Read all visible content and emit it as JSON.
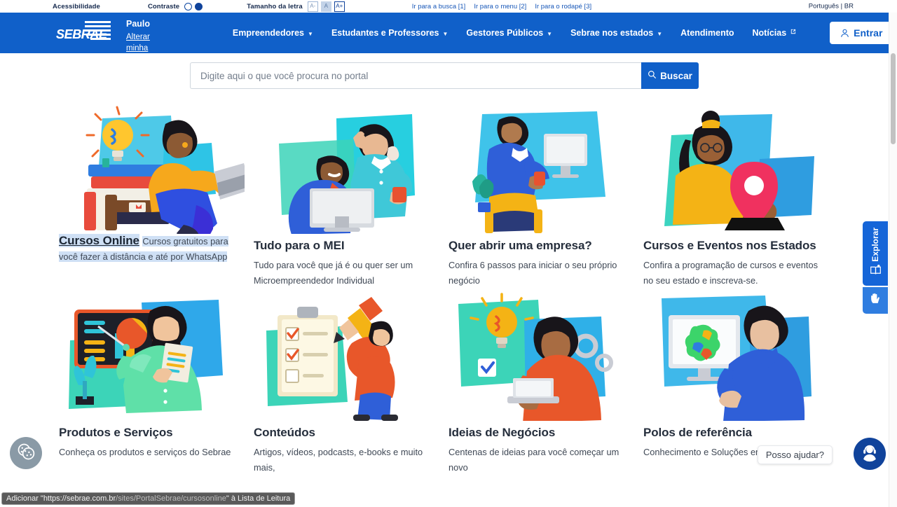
{
  "accessibility_bar": {
    "accessibility_label": "Acessibilidade",
    "contrast_label": "Contraste",
    "font_size_label": "Tamanho da letra",
    "font_small": "A-",
    "font_normal": "A",
    "font_large": "A+",
    "skip_links": [
      "Ir para a busca [1]",
      "Ir para o menu [2]",
      "Ir para o rodapé [3]"
    ],
    "language": "Português | BR"
  },
  "navbar": {
    "logo_text": "SEBRAE",
    "location_city": "São Paulo",
    "location_change": "Alterar minha localização",
    "menu": [
      {
        "label": "Empreendedores",
        "has_chevron": true,
        "external": false
      },
      {
        "label": "Estudantes e Professores",
        "has_chevron": true,
        "external": false
      },
      {
        "label": "Gestores Públicos",
        "has_chevron": true,
        "external": false
      },
      {
        "label": "Sebrae nos estados",
        "has_chevron": true,
        "external": false
      },
      {
        "label": "Atendimento",
        "has_chevron": false,
        "external": false
      },
      {
        "label": "Notícias",
        "has_chevron": false,
        "external": true
      }
    ],
    "login_label": "Entrar",
    "login_icon": "person-icon",
    "brand_color": "#1060c9"
  },
  "search": {
    "placeholder": "Digite aqui o que você procura no portal",
    "value": "",
    "button_label": "Buscar",
    "button_icon": "search-icon"
  },
  "cards": [
    {
      "title": "Cursos Online",
      "description": "Cursos gratuitos para você fazer à distância e até por WhatsApp",
      "selected": true,
      "art": "person-on-books-with-laptop"
    },
    {
      "title": "Tudo para o MEI",
      "description": "Tudo para você que já é ou quer ser um Microempreendedor Individual",
      "selected": false,
      "art": "two-people-at-monitor"
    },
    {
      "title": "Quer abrir uma empresa?",
      "description": "Confira 6 passos para iniciar o seu próprio negócio",
      "selected": false,
      "art": "person-at-desk-computer"
    },
    {
      "title": "Cursos e Eventos nos Estados",
      "description": "Confira a programação de cursos e eventos no seu estado e inscreva-se.",
      "selected": false,
      "art": "woman-with-map-pin"
    },
    {
      "title": "Produtos e Serviços",
      "description": "Conheça os produtos e serviços do Sebrae",
      "selected": false,
      "art": "man-presenting-chart-board"
    },
    {
      "title": "Conteúdos",
      "description": "Artigos, vídeos, podcasts, e-books e muito mais,",
      "selected": false,
      "art": "checklist-with-pencil"
    },
    {
      "title": "Ideias de Negócios",
      "description": "Centenas de ideias para você começar um novo",
      "selected": false,
      "art": "woman-with-lightbulb-laptop"
    },
    {
      "title": "Polos de referência",
      "description": "Conhecimento e Soluções em unidades de",
      "selected": false,
      "art": "man-at-screen-with-brazil-map"
    }
  ],
  "side_widgets": {
    "explorar_label": "Explorar",
    "explorar_icon": "book-reader-icon",
    "libras_icon": "sign-language-hand-icon"
  },
  "chat": {
    "bubble_text": "Posso ajudar?",
    "button_icon": "headset-agent-icon"
  },
  "cookie": {
    "icon": "cookie-icon"
  },
  "status_tooltip": {
    "prefix": "Adicionar \"https://",
    "domain": "sebrae.com.br",
    "path": "/sites/PortalSebrae/cursosonline",
    "suffix": "\" à Lista de Leitura"
  }
}
